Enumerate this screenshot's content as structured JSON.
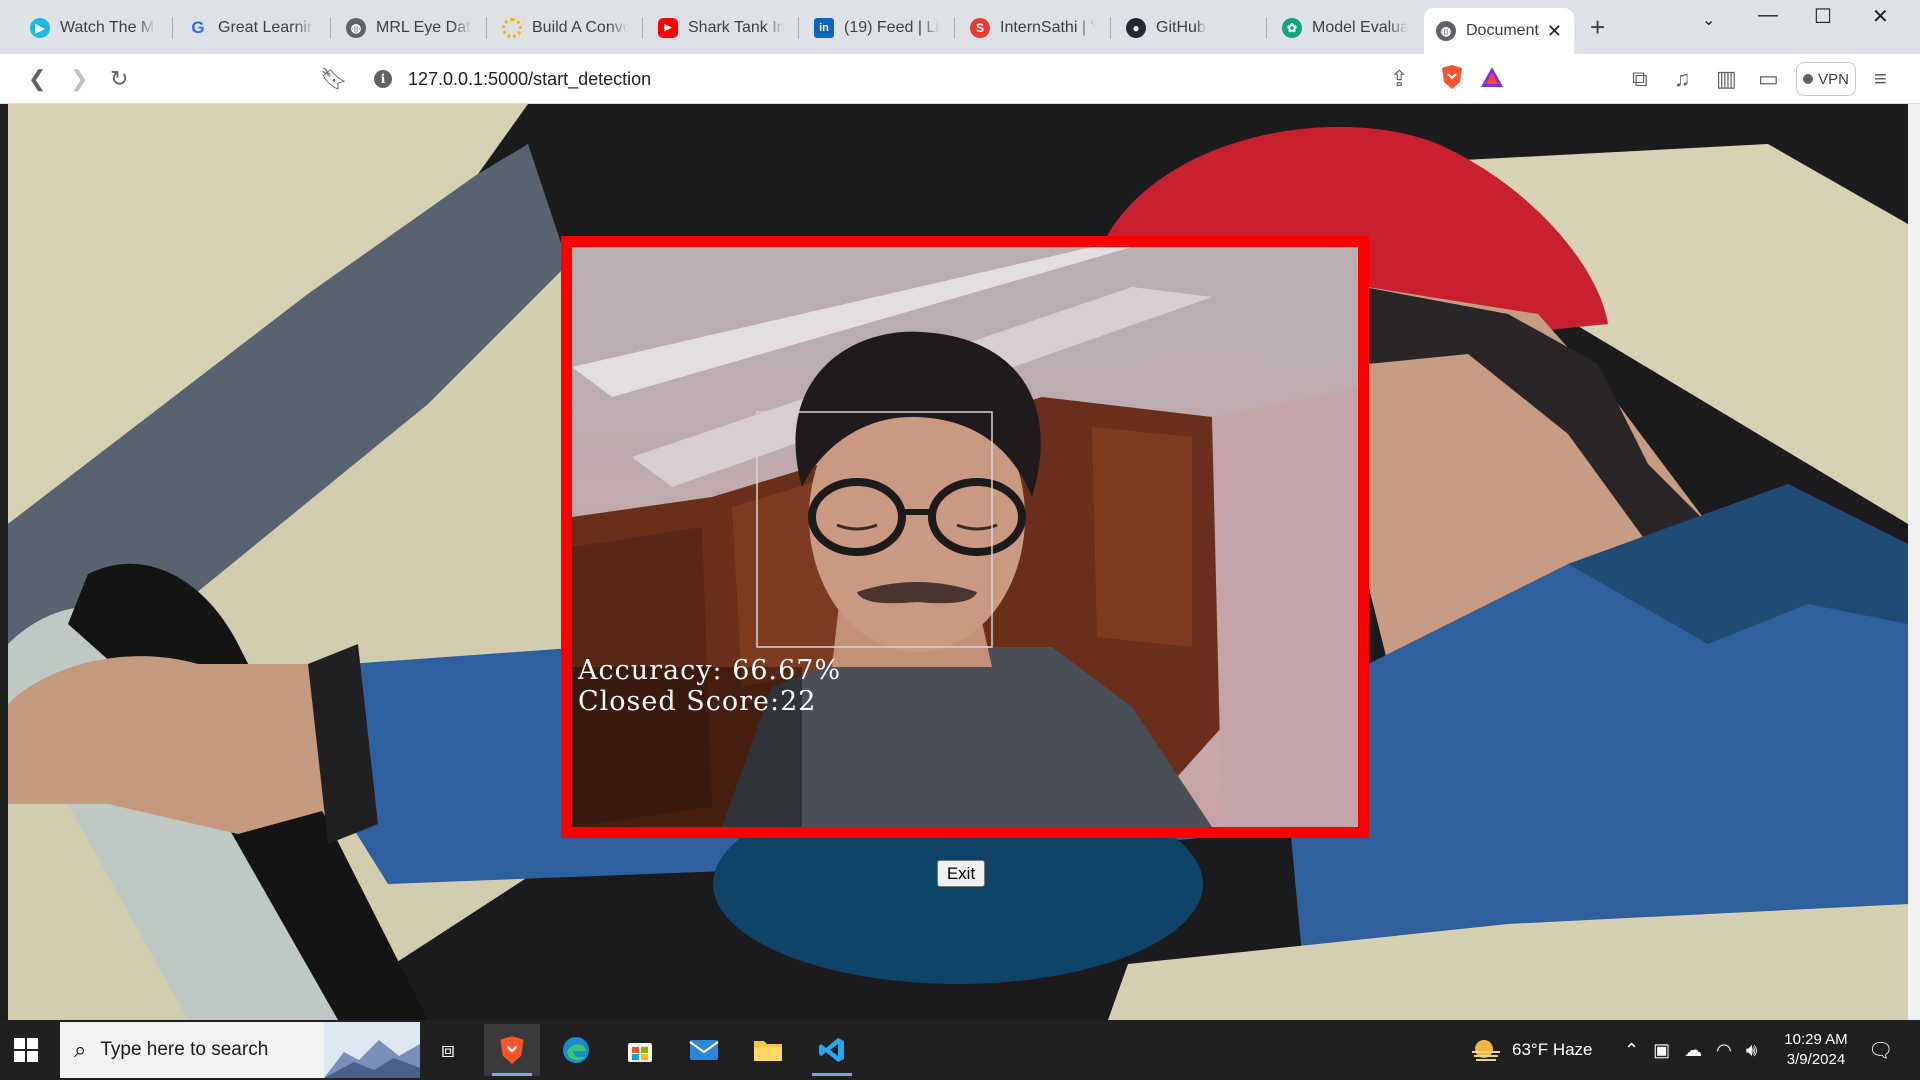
{
  "browser": {
    "tabs": [
      {
        "title": "Watch The Mat",
        "icon": "play-icon",
        "color": "#1ab7ea"
      },
      {
        "title": "Great Learning",
        "icon": "g-icon",
        "color": "#1a73e8"
      },
      {
        "title": "MRL Eye Datas",
        "icon": "globe-icon",
        "color": "#5f6368"
      },
      {
        "title": "Build A Convol",
        "icon": "loader-icon",
        "color": "#f4b400"
      },
      {
        "title": "Shark Tank Indi",
        "icon": "youtube-icon",
        "color": "#ff0000"
      },
      {
        "title": "(19) Feed | Link",
        "icon": "linkedin-icon",
        "color": "#0a66c2"
      },
      {
        "title": "InternSathi | Yo",
        "icon": "internsathi-icon",
        "color": "#e53935"
      },
      {
        "title": "GitHub",
        "icon": "github-icon",
        "color": "#24292f"
      },
      {
        "title": "Model Evaluati",
        "icon": "openai-icon",
        "color": "#10a37f"
      },
      {
        "title": "Document",
        "icon": "globe-icon",
        "color": "#5f6368",
        "active": true
      }
    ],
    "url": "127.0.0.1:5000/start_detection",
    "vpn_label": "VPN"
  },
  "detection": {
    "accuracy_text": "Accuracy: 66.67%",
    "status_text": "Closed Score:22",
    "border_color": "#ff0000"
  },
  "exit_button": {
    "label": "Exit"
  },
  "taskbar": {
    "search_placeholder": "Type here to search",
    "weather": "63°F Haze",
    "time": "10:29 AM",
    "date": "3/9/2024"
  }
}
